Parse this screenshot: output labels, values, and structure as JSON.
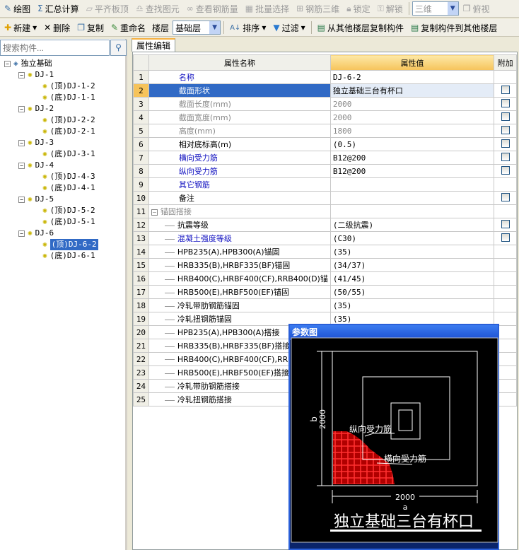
{
  "toolbar1": {
    "items": [
      {
        "label": "绘图",
        "icon": "draw-icon",
        "enabled": true
      },
      {
        "label": "汇总计算",
        "icon": "sigma-icon",
        "enabled": true
      },
      {
        "label": "平齐板顶",
        "icon": "align-icon",
        "enabled": false
      },
      {
        "label": "查找图元",
        "icon": "binoculars-icon",
        "enabled": false
      },
      {
        "label": "查看钢筋量",
        "icon": "rebar-icon",
        "enabled": false
      },
      {
        "label": "批量选择",
        "icon": "batch-select-icon",
        "enabled": false
      },
      {
        "label": "钢筋三维",
        "icon": "rebar-3d-icon",
        "enabled": false
      },
      {
        "label": "锁定",
        "icon": "lock-icon",
        "enabled": false
      },
      {
        "label": "解锁",
        "icon": "unlock-icon",
        "enabled": false
      }
    ],
    "view_select": "三维",
    "view_btn": "俯视"
  },
  "toolbar2": {
    "new": "新建",
    "delete": "删除",
    "copy": "复制",
    "rename": "重命名",
    "floor_label": "楼层",
    "floor_value": "基础层",
    "sort": "排序",
    "filter": "过滤",
    "copy_from": "从其他楼层复制构件",
    "copy_to": "复制构件到其他楼层"
  },
  "search": {
    "placeholder": "搜索构件..."
  },
  "tree": {
    "root": "独立基础",
    "groups": [
      {
        "name": "DJ-1",
        "children": [
          "(顶)DJ-1-2",
          "(底)DJ-1-1"
        ]
      },
      {
        "name": "DJ-2",
        "children": [
          "(顶)DJ-2-2",
          "(底)DJ-2-1"
        ]
      },
      {
        "name": "DJ-3",
        "children": [
          "(底)DJ-3-1"
        ]
      },
      {
        "name": "DJ-4",
        "children": [
          "(顶)DJ-4-3",
          "(底)DJ-4-1"
        ]
      },
      {
        "name": "DJ-5",
        "children": [
          "(顶)DJ-5-2",
          "(底)DJ-5-1"
        ]
      },
      {
        "name": "DJ-6",
        "children": [
          "(顶)DJ-6-2",
          "(底)DJ-6-1"
        ]
      }
    ],
    "selected": "(顶)DJ-6-2"
  },
  "tab": "属性编辑",
  "grid": {
    "headers": [
      "属性名称",
      "属性值",
      "附加"
    ],
    "rows": [
      {
        "n": "1",
        "name": "名称",
        "value": "DJ-6-2",
        "style": "blue",
        "cb": false
      },
      {
        "n": "2",
        "name": "截面形状",
        "value": "独立基础三台有杯口",
        "style": "sel",
        "cb": true
      },
      {
        "n": "3",
        "name": "截面长度(mm)",
        "value": "2000",
        "style": "gray",
        "cb": true
      },
      {
        "n": "4",
        "name": "截面宽度(mm)",
        "value": "2000",
        "style": "gray",
        "cb": true
      },
      {
        "n": "5",
        "name": "高度(mm)",
        "value": "1800",
        "style": "gray",
        "cb": true
      },
      {
        "n": "6",
        "name": "相对底标高(m)",
        "value": "(0.5)",
        "style": "",
        "cb": true
      },
      {
        "n": "7",
        "name": "横向受力筋",
        "value": "B12@200",
        "style": "blue",
        "cb": true
      },
      {
        "n": "8",
        "name": "纵向受力筋",
        "value": "B12@200",
        "style": "blue",
        "cb": true
      },
      {
        "n": "9",
        "name": "其它钢筋",
        "value": "",
        "style": "blue",
        "cb": false
      },
      {
        "n": "10",
        "name": "备注",
        "value": "",
        "style": "",
        "cb": true
      },
      {
        "n": "11",
        "name": "锚固搭接",
        "value": "",
        "style": "group",
        "cb": false
      },
      {
        "n": "12",
        "name": "抗震等级",
        "value": "(二级抗震)",
        "style": "sub",
        "cb": true
      },
      {
        "n": "13",
        "name": "混凝土强度等级",
        "value": "(C30)",
        "style": "sub blue",
        "cb": true
      },
      {
        "n": "14",
        "name": "HPB235(A),HPB300(A)锚固",
        "value": "(35)",
        "style": "sub",
        "cb": false
      },
      {
        "n": "15",
        "name": "HRB335(B),HRBF335(BF)锚固",
        "value": "(34/37)",
        "style": "sub",
        "cb": false
      },
      {
        "n": "16",
        "name": "HRB400(C),HRBF400(CF),RRB400(D)锚",
        "value": "(41/45)",
        "style": "sub",
        "cb": false
      },
      {
        "n": "17",
        "name": "HRB500(E),HRBF500(EF)锚固",
        "value": "(50/55)",
        "style": "sub",
        "cb": false
      },
      {
        "n": "18",
        "name": "冷轧带肋钢筋锚固",
        "value": "(35)",
        "style": "sub",
        "cb": false
      },
      {
        "n": "19",
        "name": "冷轧扭钢筋锚固",
        "value": "(35)",
        "style": "sub",
        "cb": false
      },
      {
        "n": "20",
        "name": "HPB235(A),HPB300(A)搭接",
        "value": "",
        "style": "sub",
        "cb": false
      },
      {
        "n": "21",
        "name": "HRB335(B),HRBF335(BF)搭接",
        "value": "",
        "style": "sub",
        "cb": false
      },
      {
        "n": "22",
        "name": "HRB400(C),HRBF400(CF),RRB400",
        "value": "",
        "style": "sub",
        "cb": false
      },
      {
        "n": "23",
        "name": "HRB500(E),HRBF500(EF)搭接",
        "value": "",
        "style": "sub",
        "cb": false
      },
      {
        "n": "24",
        "name": "冷轧带肋钢筋搭接",
        "value": "",
        "style": "sub",
        "cb": false
      },
      {
        "n": "25",
        "name": "冷轧扭钢筋搭接",
        "value": "",
        "style": "sub",
        "cb": false
      }
    ]
  },
  "popup": {
    "title": "参数图",
    "dim_b": "2000",
    "label_b": "b",
    "dim_a": "2000",
    "label_a": "a",
    "rebar_long": "纵向受力筋",
    "rebar_trans": "横向受力筋",
    "caption": "独立基础三台有杯口",
    "colors": {
      "bg": "#000000",
      "lines": "#ffffff",
      "hatch": "#ff2020"
    }
  }
}
